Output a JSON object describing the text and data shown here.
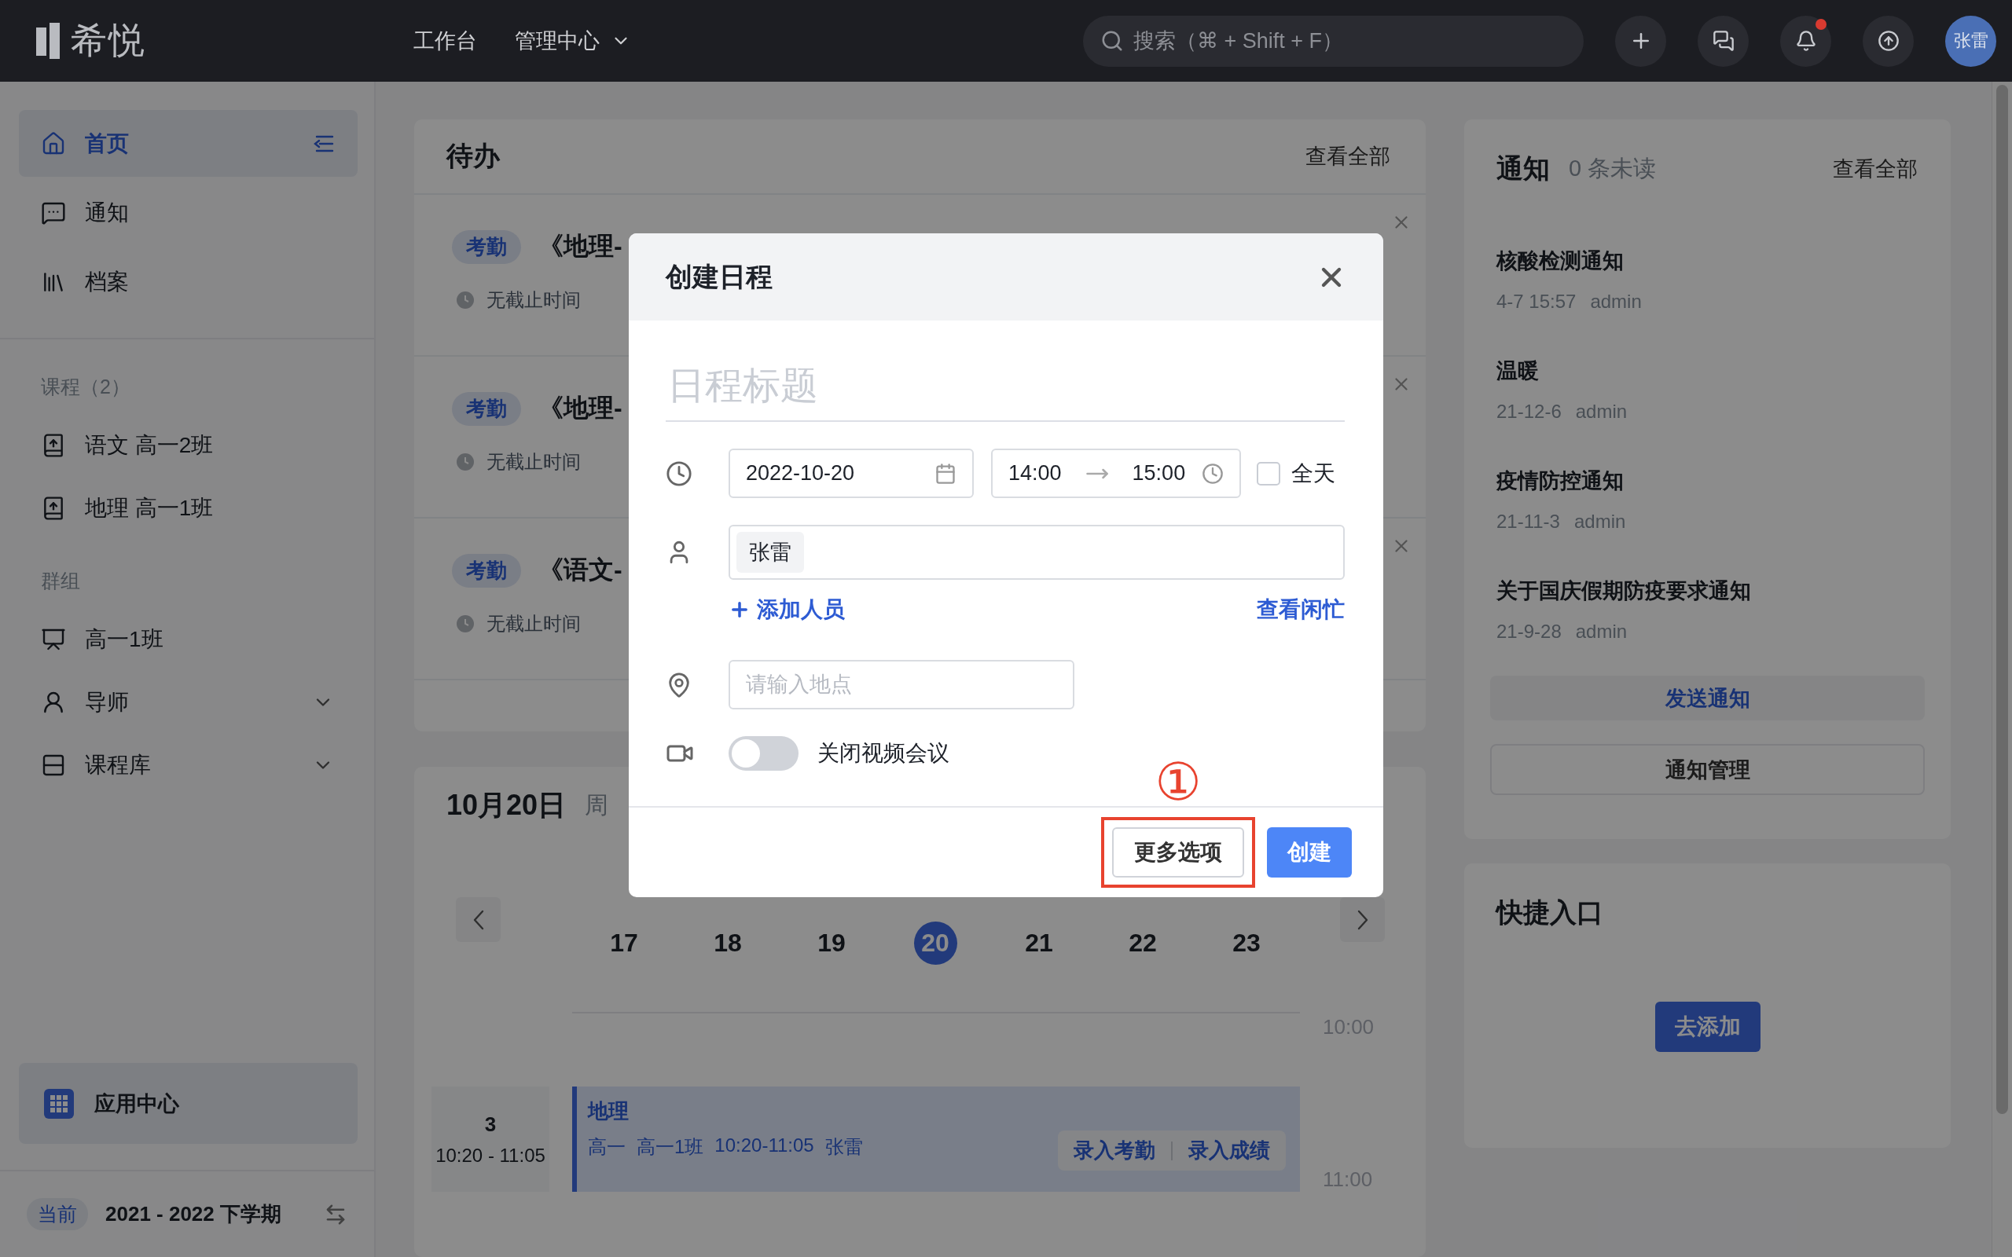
{
  "topbar": {
    "logo": "希悦",
    "nav": [
      {
        "label": "工作台",
        "dropdown": false
      },
      {
        "label": "管理中心",
        "dropdown": true
      }
    ],
    "search": {
      "placeholder": "搜索（⌘ + Shift + F）"
    },
    "unread_badge": true,
    "avatar": "张雷"
  },
  "sidebar": {
    "items": [
      {
        "label": "首页",
        "kind": "home",
        "selected": true
      },
      {
        "label": "通知",
        "kind": "message",
        "selected": false
      },
      {
        "label": "档案",
        "kind": "archive",
        "selected": false
      }
    ],
    "sections": [
      {
        "title": "课程（2）",
        "items": [
          {
            "label": "语文 高一2班",
            "kind": "course",
            "expandable": false
          },
          {
            "label": "地理 高一1班",
            "kind": "course",
            "expandable": false
          }
        ]
      },
      {
        "title": "群组",
        "items": [
          {
            "label": "高一1班",
            "kind": "group",
            "expandable": false
          },
          {
            "label": "导师",
            "kind": "tutor",
            "expandable": true
          },
          {
            "label": "课程库",
            "kind": "library",
            "expandable": true
          }
        ]
      }
    ],
    "app_center": "应用中心",
    "term": {
      "badge": "当前",
      "label": "2021 - 2022 下学期"
    }
  },
  "todo": {
    "title": "待办",
    "view_all": "查看全部",
    "items": [
      {
        "tag": "考勤",
        "title": "《地理-",
        "deadline": "无截止时间"
      },
      {
        "tag": "考勤",
        "title": "《地理-",
        "deadline": "无截止时间"
      },
      {
        "tag": "考勤",
        "title": "《语文-",
        "deadline": "无截止时间"
      }
    ]
  },
  "calendar": {
    "date": "10月20日",
    "weekday": "周",
    "days": [
      {
        "label": "17",
        "selected": false
      },
      {
        "label": "18",
        "selected": false
      },
      {
        "label": "19",
        "selected": false
      },
      {
        "label": "20",
        "selected": true
      },
      {
        "label": "21",
        "selected": false
      },
      {
        "label": "22",
        "selected": false
      },
      {
        "label": "23",
        "selected": false
      }
    ],
    "time_labels": [
      "10:00",
      "11:00"
    ],
    "lesson": {
      "period": "3",
      "time": "10:20 - 11:05",
      "subject": "地理",
      "details": [
        "高一",
        "高一1班",
        "10:20-11:05",
        "张雷"
      ],
      "actions": [
        "录入考勤",
        "录入成绩"
      ]
    }
  },
  "notices": {
    "title": "通知",
    "unread": "0 条未读",
    "view_all": "查看全部",
    "items": [
      {
        "title": "核酸检测通知",
        "time": "4-7 15:57",
        "author": "admin"
      },
      {
        "title": "温暖",
        "time": "21-12-6",
        "author": "admin"
      },
      {
        "title": "疫情防控通知",
        "time": "21-11-3",
        "author": "admin"
      },
      {
        "title": "关于国庆假期防疫要求通知",
        "time": "21-9-28",
        "author": "admin"
      }
    ],
    "buttons": [
      {
        "label": "发送通知",
        "kind": "primary"
      },
      {
        "label": "通知管理",
        "kind": "outline"
      }
    ]
  },
  "quick": {
    "title": "快捷入口",
    "button": "去添加"
  },
  "modal": {
    "title": "创建日程",
    "title_placeholder": "日程标题",
    "date": "2022-10-20",
    "start": "14:00",
    "end": "15:00",
    "all_day": {
      "label": "全天",
      "checked": false
    },
    "members": [
      "张雷"
    ],
    "add_member": "添加人员",
    "free_busy": "查看闲忙",
    "location_placeholder": "请输入地点",
    "video": {
      "label": "关闭视频会议",
      "on": false
    },
    "buttons": [
      {
        "label": "更多选项",
        "kind": "default",
        "highlighted": true,
        "annotation": "①"
      },
      {
        "label": "创建",
        "kind": "primary",
        "highlighted": false
      }
    ]
  }
}
